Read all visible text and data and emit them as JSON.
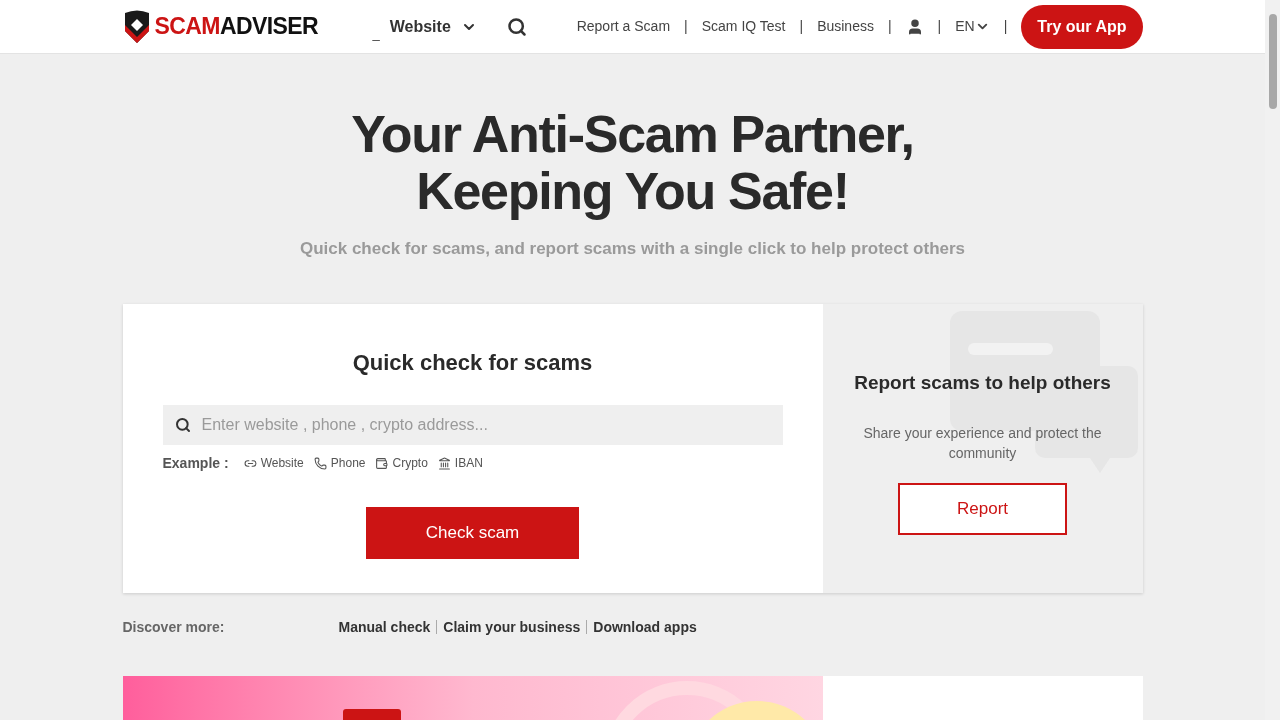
{
  "header": {
    "logo": {
      "part_1": "SCAM",
      "part_2": "ADVISER"
    },
    "marker": "_",
    "type_selector": "Website",
    "nav": [
      "Report a Scam",
      "Scam IQ Test",
      "Business"
    ],
    "separator": "|",
    "language": "EN",
    "app_button": "Try our App"
  },
  "hero": {
    "title_line_1": "Your Anti-Scam Partner,",
    "title_line_2": "Keeping You Safe!",
    "subtitle": "Quick check for scams, and report scams with a single click to help protect others"
  },
  "quick_check": {
    "title": "Quick check for scams",
    "search": {
      "placeholder": "Enter website , phone , crypto address..."
    },
    "example_label": "Example :",
    "examples": [
      {
        "kind": "link",
        "label": "Website"
      },
      {
        "kind": "phone",
        "label": "Phone"
      },
      {
        "kind": "wallet",
        "label": "Crypto"
      },
      {
        "kind": "bank",
        "label": "IBAN"
      }
    ],
    "button": "Check scam"
  },
  "report": {
    "title": "Report scams to help others",
    "text": "Share your experience and protect the community",
    "button": "Report"
  },
  "discover": {
    "label": "Discover more:",
    "links": [
      "Manual check",
      "Claim your business",
      "Download apps"
    ]
  }
}
